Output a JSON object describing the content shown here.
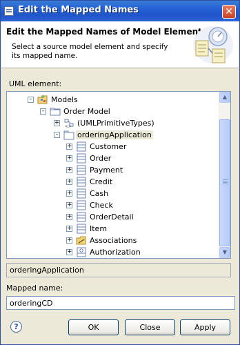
{
  "window": {
    "title": "Edit the Mapped Names"
  },
  "header": {
    "title": "Edit the Mapped Names of Model Element",
    "description": "Select a source model element and specify its mapped name."
  },
  "uml_label": "UML element:",
  "tree": [
    {
      "label": "Models",
      "icon": "models-folder-icon",
      "expander": "-",
      "depth": 0
    },
    {
      "label": "Order Model",
      "icon": "model-icon",
      "expander": "-",
      "depth": 1
    },
    {
      "label": "(UMLPrimitiveTypes)",
      "icon": "primitive-types-icon",
      "expander": "+",
      "depth": 2
    },
    {
      "label": "orderingApplication",
      "icon": "package-icon",
      "expander": "-",
      "depth": 2,
      "selected": true
    },
    {
      "label": "Customer",
      "icon": "class-icon",
      "expander": "+",
      "depth": 3
    },
    {
      "label": "Order",
      "icon": "class-icon",
      "expander": "+",
      "depth": 3
    },
    {
      "label": "Payment",
      "icon": "class-icon",
      "expander": "+",
      "depth": 3
    },
    {
      "label": "Credit",
      "icon": "class-icon",
      "expander": "+",
      "depth": 3
    },
    {
      "label": "Cash",
      "icon": "class-icon",
      "expander": "+",
      "depth": 3
    },
    {
      "label": "Check",
      "icon": "class-icon",
      "expander": "+",
      "depth": 3
    },
    {
      "label": "OrderDetail",
      "icon": "class-icon",
      "expander": "+",
      "depth": 3
    },
    {
      "label": "Item",
      "icon": "class-icon",
      "expander": "+",
      "depth": 3
    },
    {
      "label": "Associations",
      "icon": "associations-folder-icon",
      "expander": "+",
      "depth": 3
    },
    {
      "label": "Authorization",
      "icon": "interface-icon",
      "expander": "+",
      "depth": 3
    }
  ],
  "selected_element": "orderingApplication",
  "mapped_label": "Mapped name:",
  "mapped_value": "orderingCD",
  "buttons": {
    "ok": "OK",
    "close": "Close",
    "apply": "Apply"
  },
  "help_glyph": "?"
}
